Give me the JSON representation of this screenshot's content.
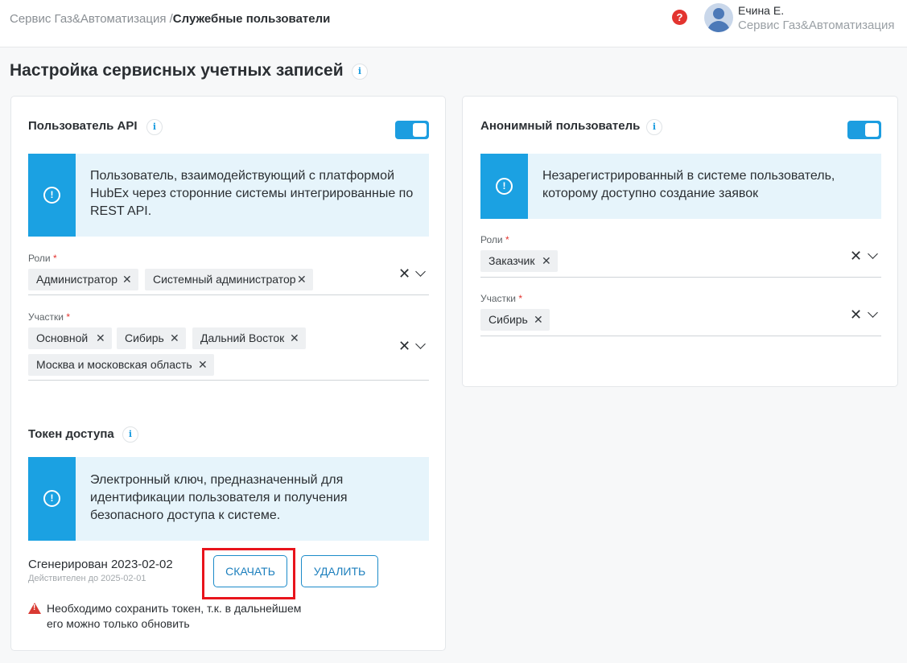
{
  "header": {
    "breadcrumb_root": "Сервис Газ&Автоматизация /",
    "breadcrumb_current": "Служебные пользователи",
    "help_icon": "question-icon",
    "user_name": "Ечина Е.",
    "user_org": "Сервис Газ&Автоматизация"
  },
  "page": {
    "title": "Настройка сервисных учетных записей"
  },
  "api_user": {
    "title": "Пользователь API",
    "enabled": true,
    "note": "Пользователь, взаимодействующий с платформой HubEx через сторонние системы интегрированные по REST API.",
    "roles_label": "Роли",
    "roles": [
      "Администратор",
      "Системный администратор"
    ],
    "sites_label": "Участки",
    "sites": [
      "Основной",
      "Сибирь",
      "Дальний Восток",
      "Москва и московская область"
    ],
    "required_mark": "*"
  },
  "token": {
    "title": "Токен доступа",
    "note": "Электронный ключ, предназначенный для идентификации пользователя и получения безопасного доступа к системе.",
    "generated": "Сгенерирован 2023-02-02",
    "valid_until": "Действителен до 2025-02-01",
    "download_label": "СКАЧАТЬ",
    "delete_label": "УДАЛИТЬ",
    "warning": "Необходимо сохранить токен, т.к. в дальнейшем его можно только обновить"
  },
  "anon_user": {
    "title": "Анонимный пользователь",
    "enabled": true,
    "note": "Незарегистрированный в системе пользователь, которому доступно создание заявок",
    "roles_label": "Роли",
    "roles": [
      "Заказчик"
    ],
    "sites_label": "Участки",
    "sites": [
      "Сибирь"
    ],
    "required_mark": "*"
  },
  "icons": {
    "clear": "✕",
    "remove_chip": "✕",
    "info": "i",
    "alert": "!"
  },
  "colors": {
    "accent": "#1c9de0",
    "note_bg": "#e6f4fb",
    "required": "#e3342f",
    "highlight": "#e8141c"
  }
}
